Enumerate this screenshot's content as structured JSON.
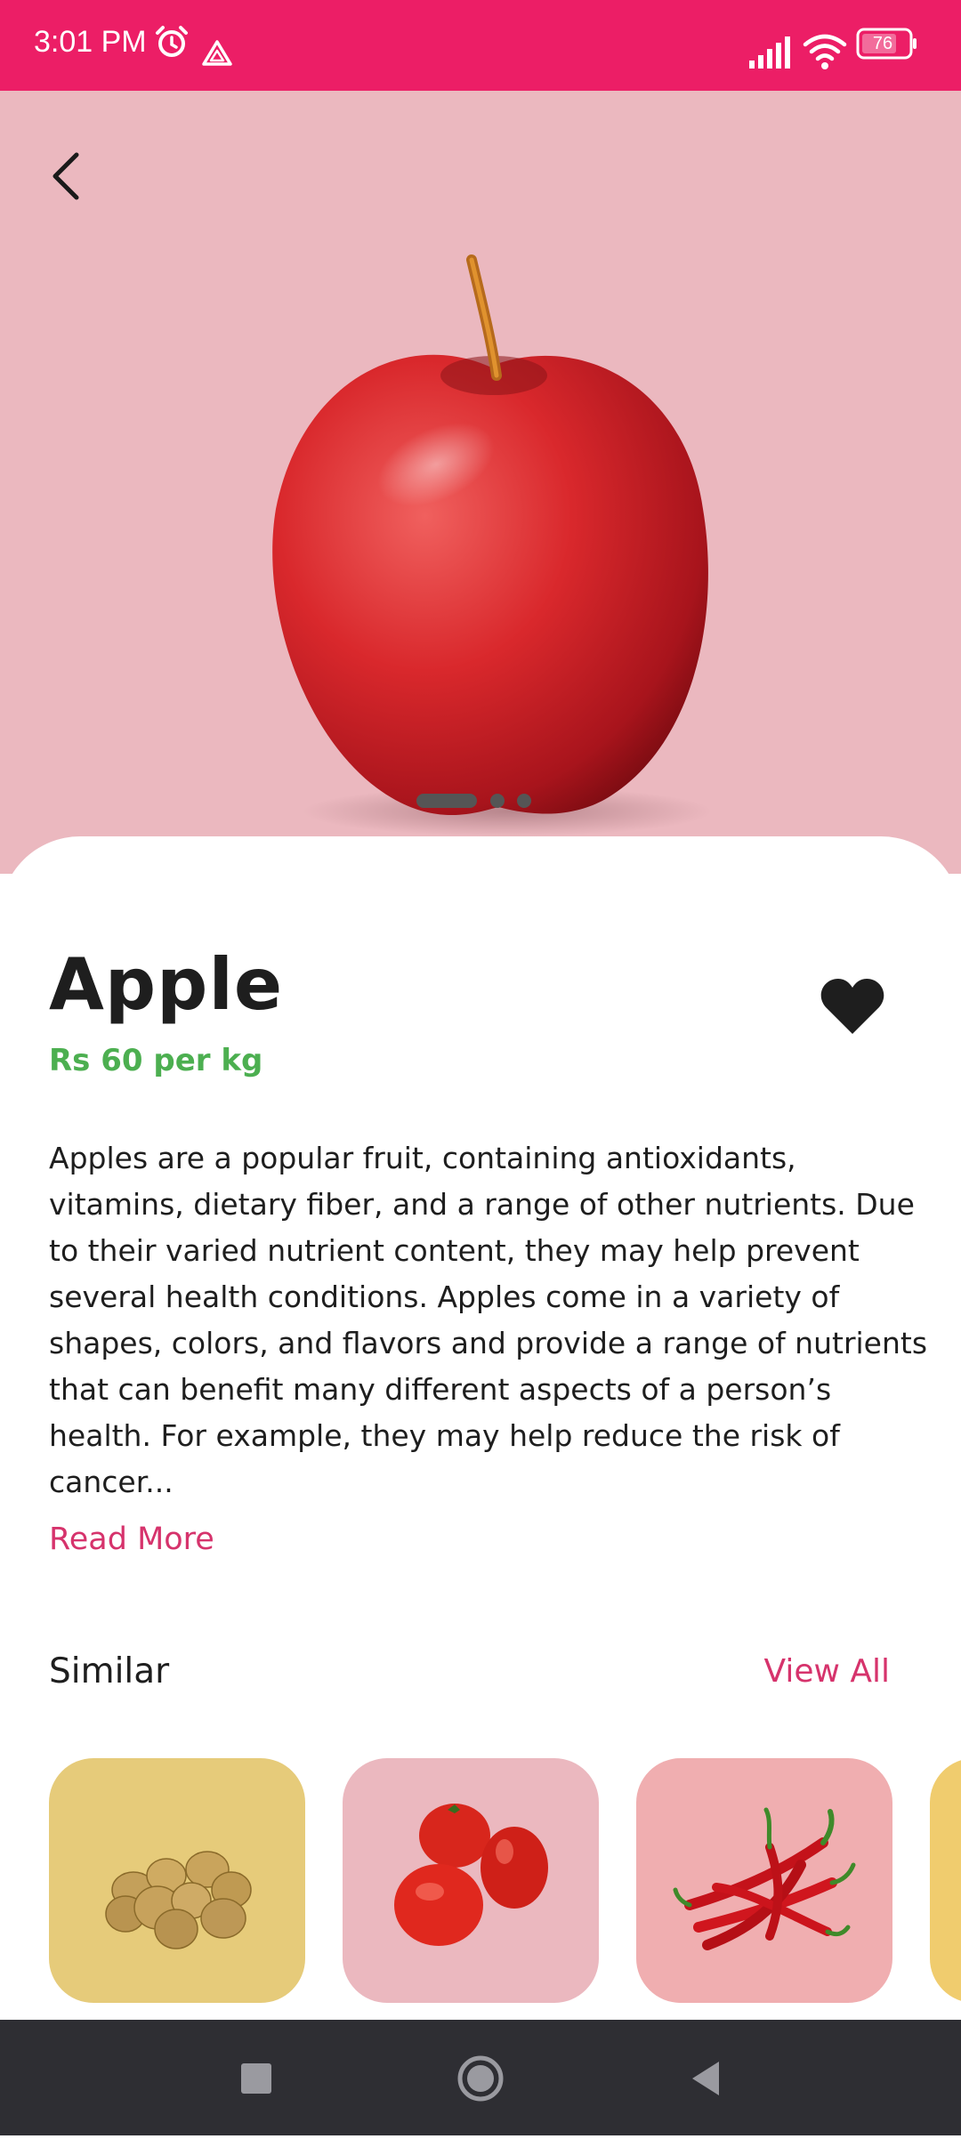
{
  "status_bar": {
    "time": "3:01 PM",
    "battery": "76",
    "icons": [
      "alarm-icon",
      "drive-icon",
      "signal-icon",
      "wifi-icon",
      "battery-icon"
    ]
  },
  "hero": {
    "background_color": "#ebb8bf",
    "image": "red-apple",
    "pager": {
      "count": 3,
      "active_index": 0
    }
  },
  "product": {
    "name": "Apple",
    "price": "Rs 60 per kg",
    "description": "Apples are a popular fruit, containing antioxidants, vitamins, dietary fiber, and a range of other nutrients. Due to their varied nutrient content, they may help prevent several health conditions. Apples come in a variety of shapes, colors, and flavors and provide a range of nutrients that can benefit many different aspects of a person’s health. For example, they may help reduce the risk of cancer...",
    "read_more": "Read More",
    "favorite": true
  },
  "similar": {
    "title": "Similar",
    "view_all": "View All",
    "items": [
      {
        "image": "potatoes",
        "bg": "#e6cb7a"
      },
      {
        "image": "tomatoes",
        "bg": "#ebb8bf"
      },
      {
        "image": "red-chillies",
        "bg": "#f0aeb0"
      },
      {
        "image": "partial-card",
        "bg": "#f0cc6e"
      }
    ]
  },
  "colors": {
    "status_bar": "#ec1e66",
    "accent": "#d6336c",
    "price": "#4caf50",
    "nav_bar": "#2e2e33"
  },
  "nav_bar": {
    "buttons": [
      "recents-icon",
      "home-icon",
      "back-icon"
    ]
  }
}
